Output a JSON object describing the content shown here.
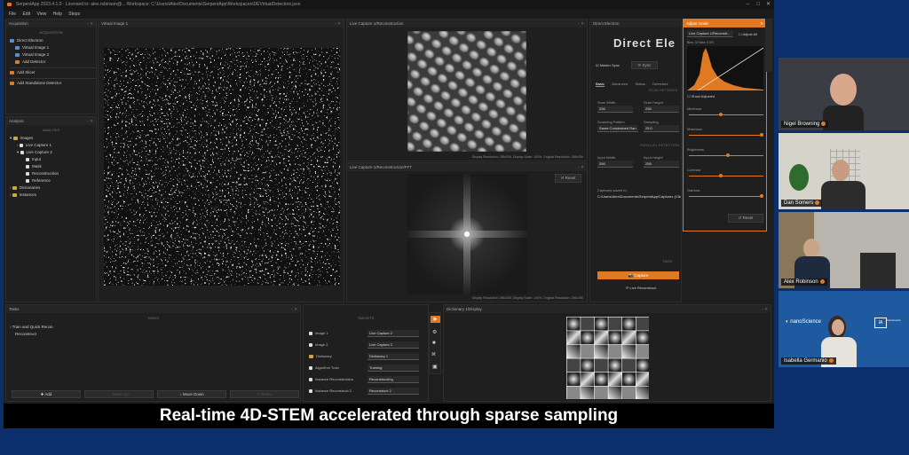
{
  "window": {
    "title": "SerpentApp 2023.4.1.0 · Licensed to: alex.robinson@...   Workspace: C:\\Users\\Alex\\Documents\\SerpentApp\\Workspaces\\DEVirtualDetectors.json",
    "minimize": "–",
    "maximize": "□",
    "close": "✕"
  },
  "menu": [
    "File",
    "Edit",
    "View",
    "Help",
    "Steps"
  ],
  "acquisition": {
    "title": "Acquisition",
    "section": "ACQUISITION",
    "items": [
      "Direct Electron",
      "Virtual Image 1",
      "Virtual Image 2"
    ],
    "add_detector": "Add Detector",
    "add_slicer": "Add Slicer",
    "add_standalone": "Add Standalone Detector"
  },
  "analysis": {
    "title": "Analysis",
    "section": "ANALYSIS",
    "tree": [
      "Images",
      "Live Capture 1",
      "Live Capture 2",
      "Input",
      "Mask",
      "Reconstruction",
      "Reference",
      "Dictionaries",
      "Instances"
    ]
  },
  "virtual_image": {
    "title": "Virtual Image 1"
  },
  "live_capture": {
    "title": "Live Capture 1/Reconstruction",
    "status": "Display Resolution: 256x256,  Display Scale: 100%,  Original Resolution: 256x256"
  },
  "fft": {
    "title": "Live Capture 1/Reconstruction/FFT",
    "reset": "Reset",
    "status": "Display Resolution: 256x256,  Display Scale: 100%,  Original Resolution: 256x256"
  },
  "direct_electron": {
    "title": "Direct Electron",
    "logo": "Direct Ele",
    "master_sync": "Master Sync",
    "sync": "Sync",
    "tabs": [
      "Basic",
      "Advanced",
      "Status",
      "Detectors"
    ],
    "scan_settings": "SCAN SETTINGS",
    "scan_width_label": "Scan Width",
    "scan_width": "256",
    "scan_height_label": "Scan Height",
    "scan_height": "256",
    "scanning_pattern_label": "Scanning Pattern",
    "scanning_pattern": "Same Constrained Ran",
    "sampling_label": "Sampling",
    "sampling": "25.0",
    "parallel_detection": "PARALLEL DETECTION",
    "input_width_label": "Input Width",
    "input_width": "256",
    "input_height_label": "Input Height",
    "input_height": "256",
    "captures_saved": "Captures saved to:",
    "captures_path": "C:\\Users\\Alex\\Documents\\SerpentApp\\Captures (Click to",
    "tags": "TAGS",
    "capture": "Capture",
    "live_reconstruct": "Live Reconstruct"
  },
  "adjust": {
    "title": "Adjust Scale",
    "source": "Live Capture 1/Reconstr...",
    "adjust_all": "Adjust All",
    "hist_label": "Bins: 32  Max: 0.5%",
    "show_adjusted": "Show Adjusted",
    "sliders": [
      "Minimum",
      "Maximum",
      "Brightness",
      "Contrast",
      "Gamma"
    ],
    "reset": "Reset"
  },
  "tasks": {
    "title": "Tasks",
    "section": "TASKS",
    "items": [
      "Train and Quick Recon",
      "Reconstruct"
    ],
    "add": "Add",
    "move_up": "Move Up",
    "move_down": "Move Down",
    "delete": "Delete"
  },
  "targets": {
    "section": "TARGETS",
    "rows": [
      {
        "label": "Image 1",
        "value": "Live Capture 2"
      },
      {
        "label": "Image 2",
        "value": "Live Capture 2"
      },
      {
        "label": "Dictionary",
        "value": "Dictionary 1"
      },
      {
        "label": "Algorithm Train",
        "value": "Training"
      },
      {
        "label": "Instance Reconstruction",
        "value": "Reconstructing"
      },
      {
        "label": "Instance Reconstruct 2",
        "value": "Reconstruct 2"
      }
    ]
  },
  "dictionary": {
    "title": "Dictionary 1/Display"
  },
  "participants": [
    {
      "name": "Nigel Browning"
    },
    {
      "name": "Dan Somers"
    },
    {
      "name": "Alex Robinson"
    },
    {
      "name": "Isabella Germanio"
    }
  ],
  "sponsor": {
    "left": "nanoScience",
    "right": "Instruments"
  },
  "caption": "Real-time 4D-STEM accelerated through sparse sampling",
  "colors": {
    "accent": "#e07a22",
    "background": "#0a2f6b",
    "app_bg": "#1e1e1e"
  }
}
